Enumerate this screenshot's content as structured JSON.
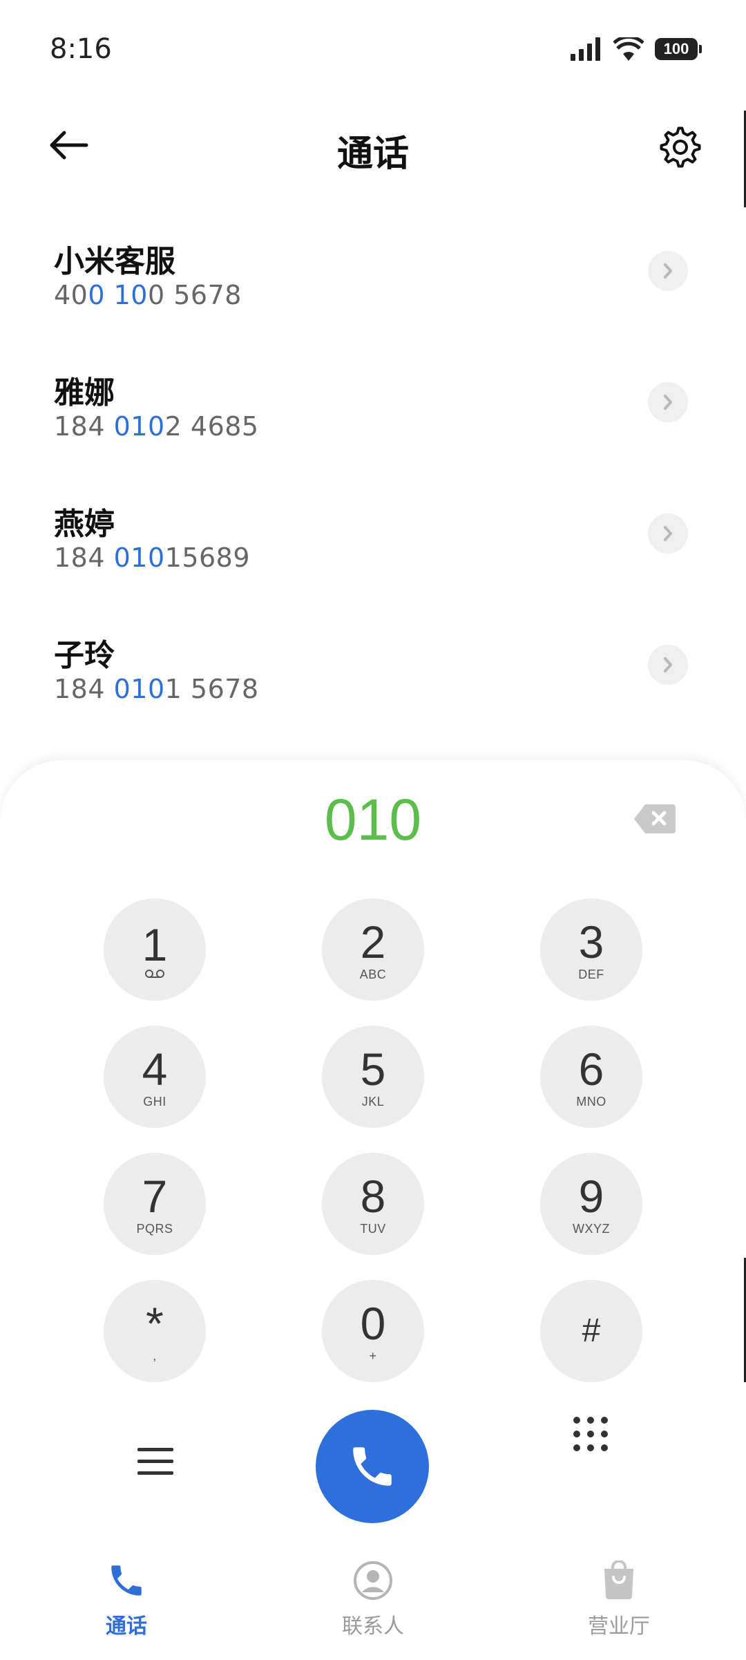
{
  "status": {
    "time": "8:16",
    "battery": "100"
  },
  "header": {
    "title": "通话"
  },
  "contacts": [
    {
      "name": "小米客服",
      "number_parts": [
        "40",
        "0 10",
        "0 5678"
      ]
    },
    {
      "name": "雅娜",
      "number_parts": [
        "184 ",
        "010",
        "2 4685"
      ]
    },
    {
      "name": "燕婷",
      "number_parts": [
        "184 ",
        "010",
        "15689"
      ]
    },
    {
      "name": "子玲",
      "number_parts": [
        "184 ",
        "010",
        "1 5678"
      ]
    }
  ],
  "dialer": {
    "dialed_number": "010"
  },
  "keys": [
    {
      "digit": "1",
      "sub": ""
    },
    {
      "digit": "2",
      "sub": "ABC"
    },
    {
      "digit": "3",
      "sub": "DEF"
    },
    {
      "digit": "4",
      "sub": "GHI"
    },
    {
      "digit": "5",
      "sub": "JKL"
    },
    {
      "digit": "6",
      "sub": "MNO"
    },
    {
      "digit": "7",
      "sub": "PQRS"
    },
    {
      "digit": "8",
      "sub": "TUV"
    },
    {
      "digit": "9",
      "sub": "WXYZ"
    },
    {
      "digit": "*",
      "sub": ","
    },
    {
      "digit": "0",
      "sub": "+"
    },
    {
      "digit": "#",
      "sub": ""
    }
  ],
  "nav": {
    "calls": "通话",
    "contacts": "联系人",
    "store": "营业厅"
  },
  "colors": {
    "accent": "#2e6ed6",
    "dialed": "#5bbe4a",
    "key_bg": "#ececec"
  }
}
